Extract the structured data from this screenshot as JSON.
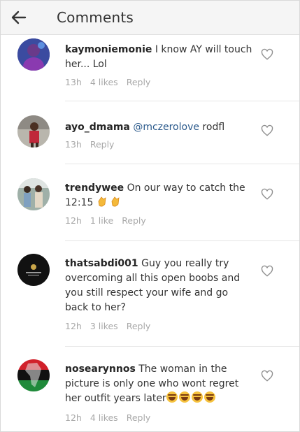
{
  "header": {
    "title": "Comments",
    "back_icon": "arrow-left-icon"
  },
  "comments": [
    {
      "username": "kaymoniemonie",
      "mention": "",
      "text": " I know AY will touch her... Lol",
      "time": "13h",
      "likes": "4 likes",
      "reply": "Reply"
    },
    {
      "username": "ayo_dmama",
      "mention": "@mczerolove",
      "text": " rodfl",
      "time": "13h",
      "likes": "",
      "reply": "Reply"
    },
    {
      "username": "trendywee",
      "mention": "",
      "text": " On our way to catch the 12:15",
      "emoji": "clapping-hands",
      "time": "12h",
      "likes": "1 like",
      "reply": "Reply"
    },
    {
      "username": "thatsabdi001",
      "mention": "",
      "text": " Guy you really try overcoming all this open boobs and you still respect your wife and go back to her?",
      "time": "12h",
      "likes": "3 likes",
      "reply": "Reply"
    },
    {
      "username": "nosearynnos",
      "mention": "",
      "text": " The woman in the picture is only one who wont regret her outfit years later",
      "emoji": "tears-of-joy",
      "time": "12h",
      "likes": "4 likes",
      "reply": "Reply"
    }
  ],
  "colors": {
    "mention": "#2b5a8c",
    "meta": "#a8a8a8",
    "header_bg": "#f5f5f5"
  }
}
